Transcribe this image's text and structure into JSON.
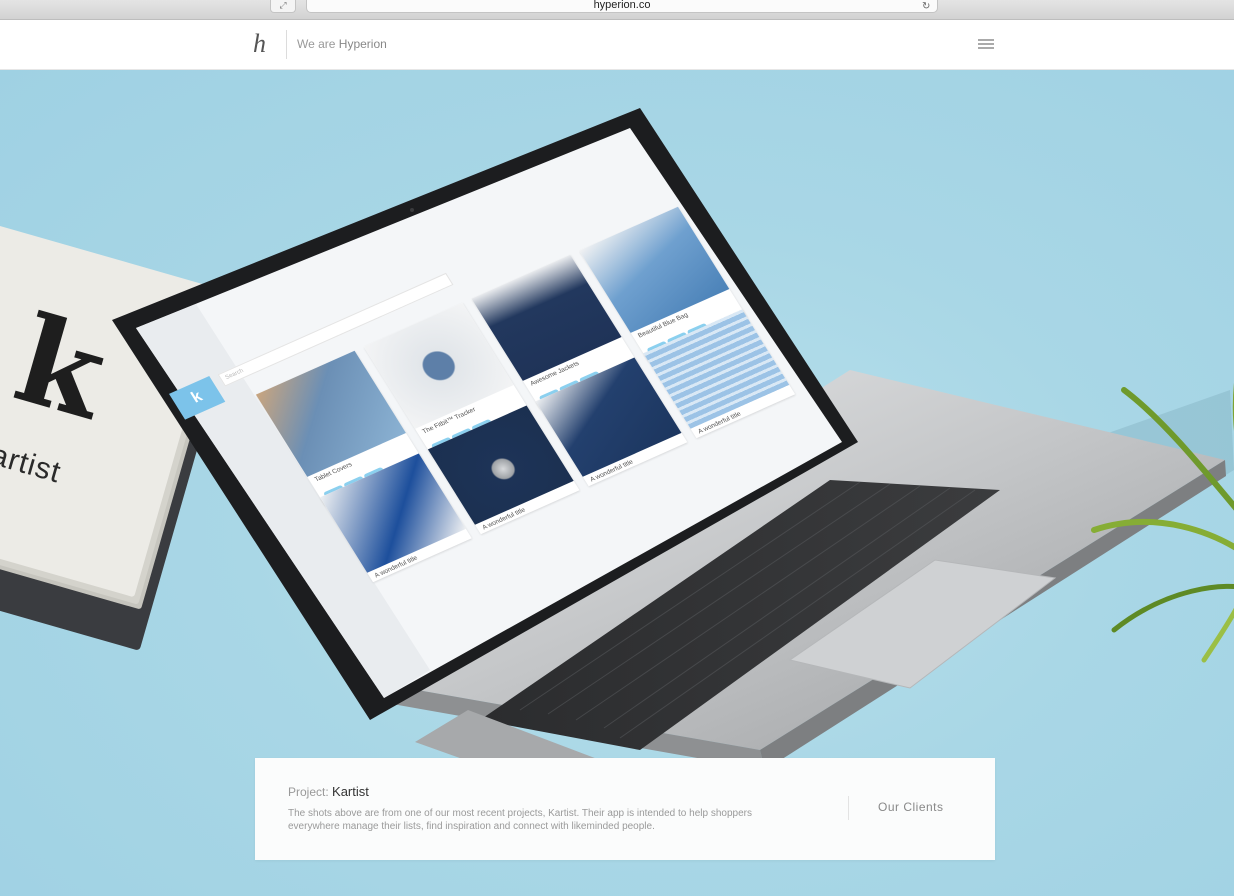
{
  "browser": {
    "url": "hyperion.co",
    "fullscreen_icon": "expand-icon",
    "reload_icon": "reload-icon"
  },
  "header": {
    "logo": "h",
    "tagline_prefix": "We are ",
    "tagline_brand": "Hyperion",
    "menu_icon": "hamburger-menu-icon"
  },
  "hero": {
    "notebook_logo": "k",
    "notebook_wordmark": "kartist",
    "app_screen": {
      "logo": "k",
      "search_placeholder": "Search",
      "cards": [
        {
          "title": "Tablet Covers"
        },
        {
          "title": "The Fitbit™ Tracker"
        },
        {
          "title": "Awesome Jackets"
        },
        {
          "title": "Beautiful Blue Bag"
        },
        {
          "title": "A wonderful title"
        },
        {
          "title": "A wonderful title"
        },
        {
          "title": "A wonderful title"
        },
        {
          "title": "A wonderful title"
        }
      ]
    }
  },
  "info_panel": {
    "project_label": "Project:",
    "project_name": "Kartist",
    "description": "The shots above are from one of our most recent projects, Kartist. Their app is intended to help shoppers everywhere manage their lists, find inspiration and connect with likeminded people.",
    "clients_link": "Our Clients"
  },
  "colors": {
    "background": "#a9d7e6",
    "accent": "#7cc3ea",
    "laptop_body": "#c9cbcd"
  }
}
